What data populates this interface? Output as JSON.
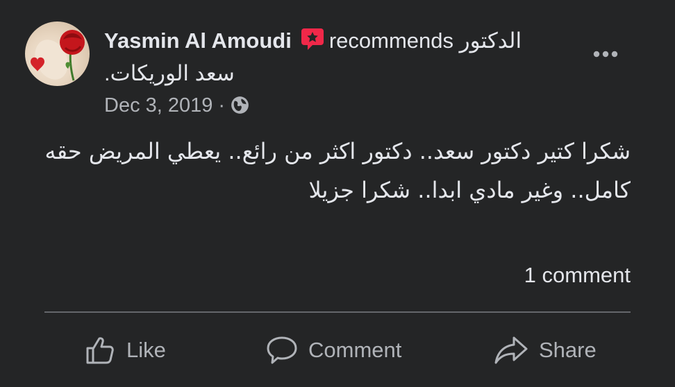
{
  "post": {
    "author": "Yasmin Al Amoudi",
    "recommend_word": "recommends",
    "page_name_part1": "الدكتور",
    "page_name_part2": "سعد الوريكات.",
    "date": "Dec 3, 2019",
    "separator": "·",
    "privacy_icon": "globe-icon",
    "more_icon": "more-options-icon",
    "body": "شكرا كتير دكتور سعد.. دكتور اكثر من رائع.. يعطي المريض حقه كامل.. وغير مادي ابدا.. شكرا جزيلا",
    "comment_count": "1 comment"
  },
  "actions": {
    "like_label": "Like",
    "comment_label": "Comment",
    "share_label": "Share"
  },
  "colors": {
    "background": "#242526",
    "text_primary": "#e4e6eb",
    "text_secondary": "#b0b3b8",
    "recommend_badge": "#f02849",
    "divider": "#65676b"
  }
}
